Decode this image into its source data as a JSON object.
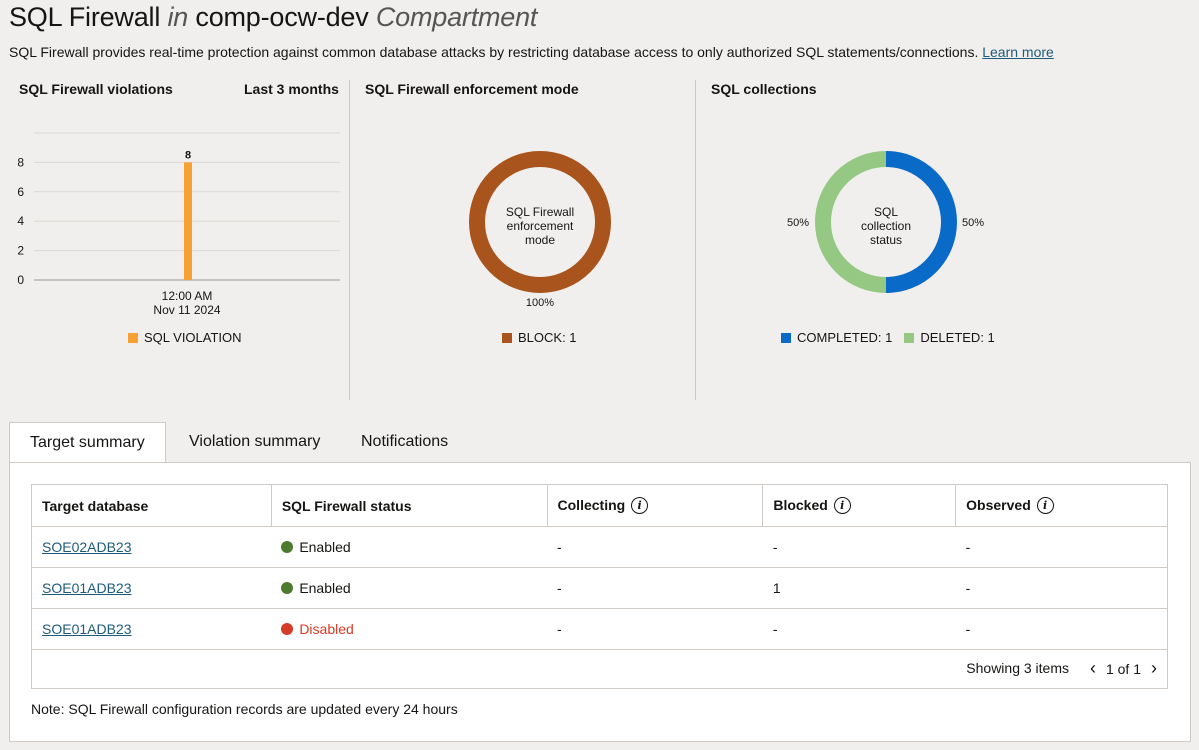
{
  "header": {
    "title_main": "SQL Firewall",
    "title_in": "in",
    "title_compartment": "comp-ocw-dev",
    "title_suffix": "Compartment",
    "description": "SQL Firewall provides real-time protection against common database attacks by restricting database access to only authorized SQL statements/connections.",
    "learn_more": "Learn more"
  },
  "violations": {
    "title": "SQL Firewall violations",
    "range": "Last 3 months",
    "legend": "SQL VIOLATION",
    "color": "#f7a033",
    "chart_data": {
      "type": "bar",
      "categories": [
        "12:00 AM Nov 11 2024"
      ],
      "values": [
        8
      ],
      "series": [
        {
          "name": "SQL VIOLATION",
          "values": [
            8
          ]
        }
      ],
      "yticks": [
        "0",
        "2",
        "4",
        "6",
        "8"
      ],
      "ylim": [
        0,
        10
      ],
      "data_label": "8",
      "x_label_line1": "12:00 AM",
      "x_label_line2": "Nov 11 2024"
    }
  },
  "enforcement": {
    "title": "SQL Firewall enforcement mode",
    "center_line1": "SQL Firewall",
    "center_line2": "enforcement",
    "center_line3": "mode",
    "pct_label": "100%",
    "legend": "BLOCK: 1",
    "color": "#a8541c",
    "chart_data": {
      "type": "pie",
      "categories": [
        "BLOCK"
      ],
      "values": [
        1
      ]
    }
  },
  "collections": {
    "title": "SQL collections",
    "center_line1": "SQL",
    "center_line2": "collection",
    "center_line3": "status",
    "left_pct": "50%",
    "right_pct": "50%",
    "legend_completed": "COMPLETED: 1",
    "legend_deleted": "DELETED: 1",
    "completed_color": "#0a6ac8",
    "deleted_color": "#95c882",
    "chart_data": {
      "type": "pie",
      "categories": [
        "COMPLETED",
        "DELETED"
      ],
      "values": [
        1,
        1
      ]
    }
  },
  "tabs": {
    "target_summary": "Target summary",
    "violation_summary": "Violation summary",
    "notifications": "Notifications"
  },
  "table": {
    "headers": {
      "target": "Target database",
      "status": "SQL Firewall status",
      "collecting": "Collecting",
      "blocked": "Blocked",
      "observed": "Observed"
    },
    "rows": [
      {
        "target": "SOE02ADB23",
        "status": "Enabled",
        "collecting": "-",
        "blocked": "-",
        "observed": "-"
      },
      {
        "target": "SOE01ADB23",
        "status": "Enabled",
        "collecting": "-",
        "blocked": "1",
        "observed": "-"
      },
      {
        "target": "SOE01ADB23",
        "status": "Disabled",
        "collecting": "-",
        "blocked": "-",
        "observed": "-"
      }
    ],
    "enabled_color": "#4d7a2c",
    "disabled_color": "#d63b25",
    "showing": "Showing 3 items",
    "page": "1 of 1",
    "info_glyph": "i"
  },
  "note": "Note: SQL Firewall configuration records are updated every 24 hours"
}
